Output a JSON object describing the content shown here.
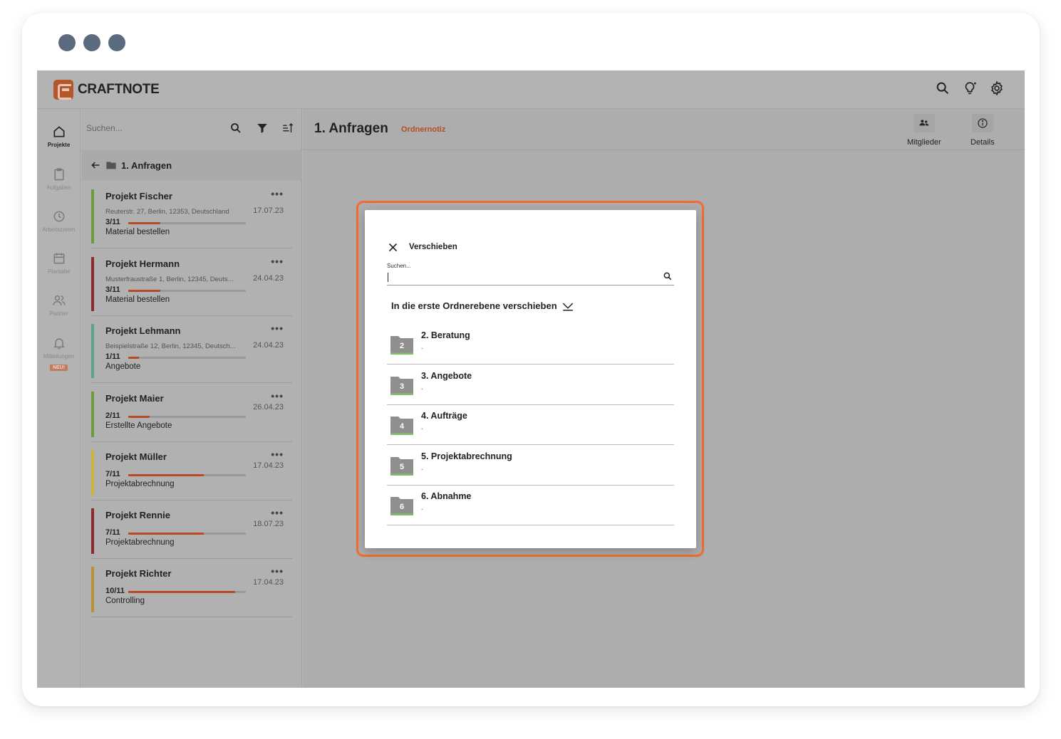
{
  "app": {
    "name": "CRAFTNOTE",
    "colors": {
      "accent": "#b84a25",
      "highlight": "#f26b33",
      "window_dots": "#5c6a80"
    }
  },
  "topbar": {
    "icons": [
      "search-icon",
      "lightbulb-icon",
      "gear-icon"
    ]
  },
  "nav": {
    "items": [
      {
        "label": "Projekte",
        "icon": "home-icon",
        "active": true
      },
      {
        "label": "Aufgaben",
        "icon": "clipboard-icon",
        "active": false
      },
      {
        "label": "Arbeitszeiten",
        "icon": "clock-icon",
        "active": false
      },
      {
        "label": "Plantafel",
        "icon": "calendar-icon",
        "active": false
      },
      {
        "label": "Partner",
        "icon": "people-icon",
        "active": false
      },
      {
        "label": "Mitteilungen",
        "icon": "bell-icon",
        "active": false,
        "badge": "NEU!"
      }
    ]
  },
  "list": {
    "search_placeholder": "Suchen...",
    "folder_title": "1. Anfragen",
    "projects": [
      {
        "name": "Projekt Fischer",
        "address": "Reuterstr. 27, Berlin, 12353, Deutschland",
        "date": "17.07.23",
        "count": "3/11",
        "progress": 0.27,
        "status": "Material bestellen",
        "color": "#6f9a3b"
      },
      {
        "name": "Projekt Hermann",
        "address": "Musterfraustraße 1, Berlin, 12345, Deuts...",
        "date": "24.04.23",
        "count": "3/11",
        "progress": 0.27,
        "status": "Material bestellen",
        "color": "#8a2a35"
      },
      {
        "name": "Projekt Lehmann",
        "address": "Beispielstraße 12, Berlin, 12345, Deutsch...",
        "date": "24.04.23",
        "count": "1/11",
        "progress": 0.09,
        "status": "Angebote",
        "color": "#5fa08a"
      },
      {
        "name": "Projekt Maier",
        "address": "",
        "date": "26.04.23",
        "count": "2/11",
        "progress": 0.18,
        "status": "Erstellte Angebote",
        "color": "#6f9a3b"
      },
      {
        "name": "Projekt Müller",
        "address": "",
        "date": "17.04.23",
        "count": "7/11",
        "progress": 0.64,
        "status": "Projektabrechnung",
        "color": "#c9b53a"
      },
      {
        "name": "Projekt Rennie",
        "address": "",
        "date": "18.07.23",
        "count": "7/11",
        "progress": 0.64,
        "status": "Projektabrechnung",
        "color": "#8a2a35"
      },
      {
        "name": "Projekt Richter",
        "address": "",
        "date": "17.04.23",
        "count": "10/11",
        "progress": 0.91,
        "status": "Controlling",
        "color": "#b8923a"
      }
    ],
    "fab_label": "+"
  },
  "main": {
    "title": "1. Anfragen",
    "note_link": "Ordnernotiz",
    "buttons": {
      "members": "Mitglieder",
      "details": "Details"
    }
  },
  "dialog": {
    "title": "Verschieben",
    "search_label": "Suchen...",
    "search_value": "",
    "move_first_level": "In die erste Ordnerebene verschieben",
    "folders": [
      {
        "number": "2",
        "name": "2. Beratung",
        "sub": "-"
      },
      {
        "number": "3",
        "name": "3. Angebote",
        "sub": "-"
      },
      {
        "number": "4",
        "name": "4. Aufträge",
        "sub": "-"
      },
      {
        "number": "5",
        "name": "5. Projektabrechnung",
        "sub": "-"
      },
      {
        "number": "6",
        "name": "6. Abnahme",
        "sub": "-"
      }
    ]
  }
}
